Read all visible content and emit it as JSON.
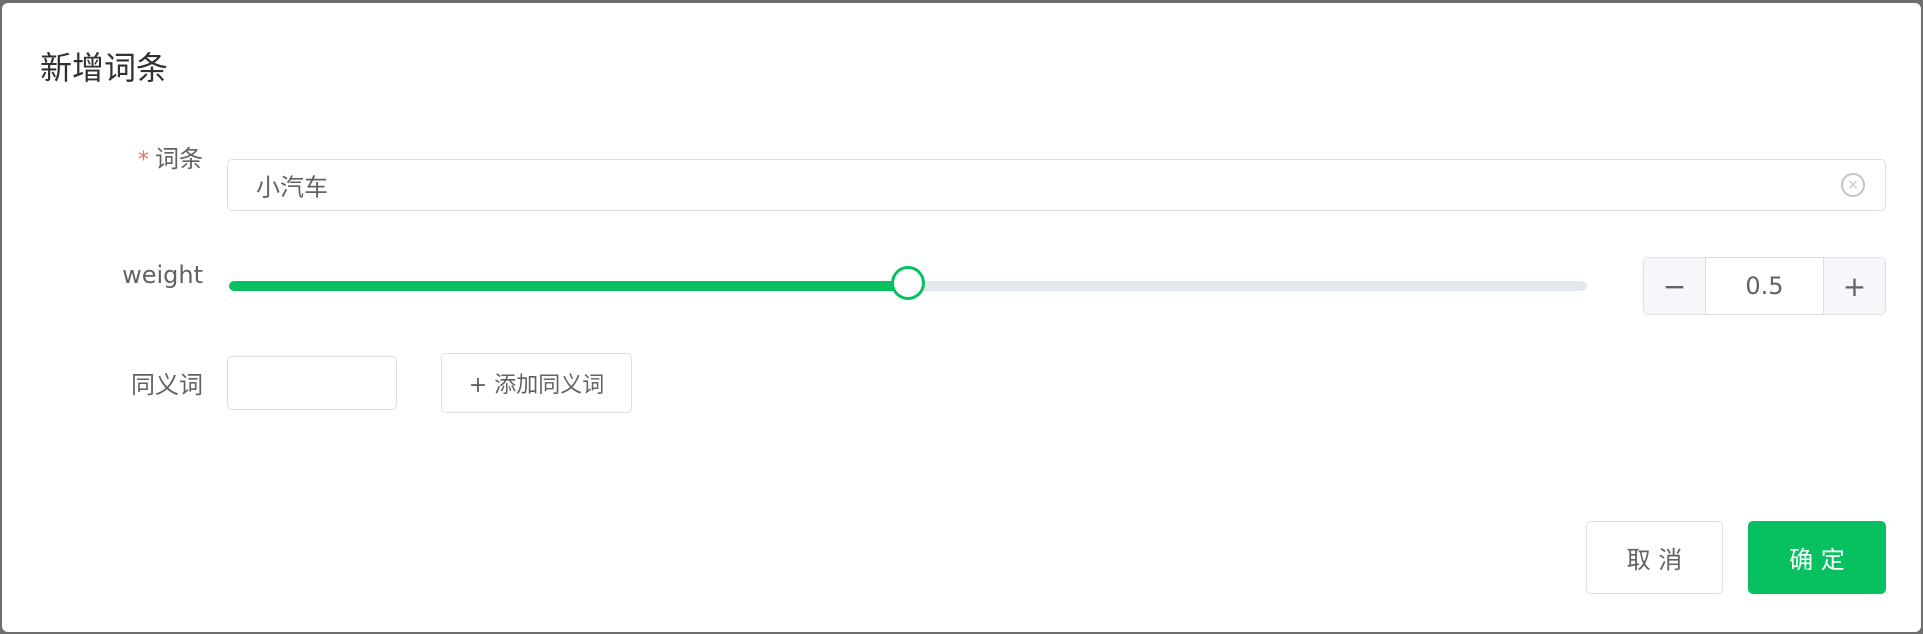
{
  "dialog": {
    "title": "新增词条"
  },
  "form": {
    "term": {
      "label": "词条",
      "required_mark": "*",
      "value": "小汽车"
    },
    "weight": {
      "label": "weight",
      "value": "0.5",
      "slider_fraction": 0.5,
      "min": 0,
      "max": 1
    },
    "synonym": {
      "label": "同义词",
      "value": "",
      "add_button": "+ 添加同义词"
    }
  },
  "footer": {
    "cancel": "取 消",
    "confirm": "确 定"
  },
  "colors": {
    "accent": "#07c160",
    "required": "#f56c6c",
    "track": "#e4e7ed"
  },
  "icons": {
    "clear": "circle-x-icon",
    "minus": "minus-icon",
    "plus": "plus-icon"
  }
}
